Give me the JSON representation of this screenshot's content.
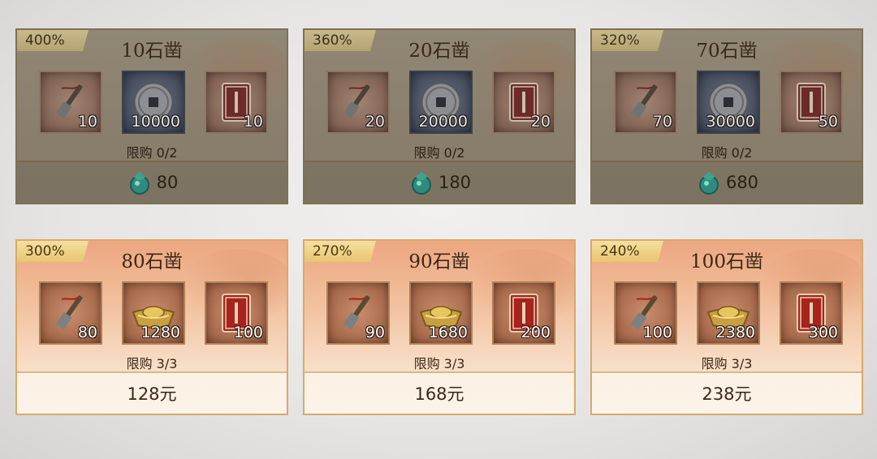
{
  "packs": [
    {
      "state": "sold",
      "bonus": "400%",
      "title": "10石凿",
      "items": [
        {
          "icon": "chisel-icon",
          "qty": "10"
        },
        {
          "icon": "copper-coin-icon",
          "qty": "10000"
        },
        {
          "icon": "red-envelope-icon",
          "qty": "10"
        }
      ],
      "limit": "限购 0/2",
      "price": "80",
      "price_icon": "jade-gem-icon"
    },
    {
      "state": "sold",
      "bonus": "360%",
      "title": "20石凿",
      "items": [
        {
          "icon": "chisel-icon",
          "qty": "20"
        },
        {
          "icon": "copper-coin-icon",
          "qty": "20000"
        },
        {
          "icon": "red-envelope-icon",
          "qty": "20"
        }
      ],
      "limit": "限购 0/2",
      "price": "180",
      "price_icon": "jade-gem-icon"
    },
    {
      "state": "sold",
      "bonus": "320%",
      "title": "70石凿",
      "items": [
        {
          "icon": "chisel-icon",
          "qty": "70"
        },
        {
          "icon": "copper-coin-icon",
          "qty": "30000"
        },
        {
          "icon": "red-envelope-icon",
          "qty": "50"
        }
      ],
      "limit": "限购 0/2",
      "price": "680",
      "price_icon": "jade-gem-icon"
    },
    {
      "state": "avail",
      "bonus": "300%",
      "title": "80石凿",
      "items": [
        {
          "icon": "chisel-icon",
          "qty": "80"
        },
        {
          "icon": "gold-ingot-icon",
          "qty": "1280"
        },
        {
          "icon": "red-envelope-icon",
          "qty": "100"
        }
      ],
      "limit": "限购 3/3",
      "price": "128元"
    },
    {
      "state": "avail",
      "bonus": "270%",
      "title": "90石凿",
      "items": [
        {
          "icon": "chisel-icon",
          "qty": "90"
        },
        {
          "icon": "gold-ingot-icon",
          "qty": "1680"
        },
        {
          "icon": "red-envelope-icon",
          "qty": "200"
        }
      ],
      "limit": "限购 3/3",
      "price": "168元"
    },
    {
      "state": "avail",
      "bonus": "240%",
      "title": "100石凿",
      "items": [
        {
          "icon": "chisel-icon",
          "qty": "100"
        },
        {
          "icon": "gold-ingot-icon",
          "qty": "2380"
        },
        {
          "icon": "red-envelope-icon",
          "qty": "300"
        }
      ],
      "limit": "限购 3/3",
      "price": "238元"
    }
  ]
}
